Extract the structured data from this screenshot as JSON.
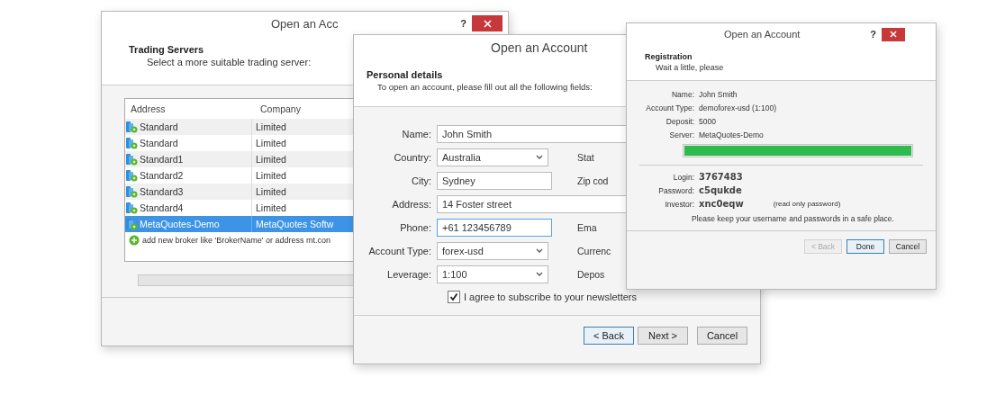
{
  "servers_dialog": {
    "title": "Open an Acc",
    "help": "?",
    "heading": "Trading Servers",
    "subheading": "Select a more suitable trading server:",
    "columns": [
      "Address",
      "Company"
    ],
    "rows": [
      {
        "address": "Standard",
        "company": "Limited",
        "selected": false
      },
      {
        "address": "Standard",
        "company": "Limited",
        "selected": false
      },
      {
        "address": "Standard1",
        "company": "Limited",
        "selected": false
      },
      {
        "address": "Standard2",
        "company": "Limited",
        "selected": false
      },
      {
        "address": "Standard3",
        "company": "Limited",
        "selected": false
      },
      {
        "address": "Standard4",
        "company": "Limited",
        "selected": false
      },
      {
        "address": "MetaQuotes-Demo",
        "company": "MetaQuotes Softw",
        "selected": true
      }
    ],
    "add_row": "add new broker like 'BrokerName' or address mt.con",
    "progress": {
      "level": 0
    }
  },
  "details_dialog": {
    "title": "Open an Account",
    "heading": "Personal details",
    "subheading": "To open an account, please fill out all the following fields:",
    "fields": [
      {
        "label": "Name:",
        "kind": "text",
        "value": "John Smith",
        "focused": false
      },
      {
        "label": "Country:",
        "kind": "select",
        "value": "Australia",
        "focused": false,
        "side_label": "Stat"
      },
      {
        "label": "City:",
        "kind": "text",
        "value": "Sydney",
        "focused": false,
        "side_label": "Zip cod"
      },
      {
        "label": "Address:",
        "kind": "text",
        "value": "14 Foster street",
        "focused": false
      },
      {
        "label": "Phone:",
        "kind": "text",
        "value": "+61 123456789",
        "focused": true,
        "side_label": "Ema"
      },
      {
        "label": "Account Type:",
        "kind": "select",
        "value": "forex-usd",
        "focused": false,
        "side_label": "Currenc"
      },
      {
        "label": "Leverage:",
        "kind": "select",
        "value": "1:100",
        "focused": false,
        "side_label": "Depos"
      }
    ],
    "newsletter": {
      "label": "I agree to subscribe to your newsletters",
      "checked": true
    },
    "buttons": [
      {
        "label": "< Back",
        "default": true
      },
      {
        "label": "Next >",
        "default": false
      },
      {
        "label": "Cancel",
        "default": false
      }
    ]
  },
  "registration_dialog": {
    "title": "Open an Account",
    "help": "?",
    "heading": "Registration",
    "subheading": "Wait a little, please",
    "summary": [
      {
        "label": "Name:",
        "value": "John Smith"
      },
      {
        "label": "Account Type:",
        "value": "demoforex-usd (1:100)"
      },
      {
        "label": "Deposit:",
        "value": "5000"
      },
      {
        "label": "Server:",
        "value": "MetaQuotes-Demo"
      }
    ],
    "progress": {
      "level": 1
    },
    "credentials": [
      {
        "label": "Login:",
        "value": "3767483"
      },
      {
        "label": "Password:",
        "value": "c5qukde"
      },
      {
        "label": "Investor:",
        "value": "xnc0eqw",
        "note": "(read only password)"
      }
    ],
    "notice": "Please keep your username and passwords in a safe place.",
    "buttons": [
      {
        "label": "< Back",
        "disabled": true,
        "default": false
      },
      {
        "label": "Done",
        "disabled": false,
        "default": true
      },
      {
        "label": "Cancel",
        "disabled": false,
        "default": false
      }
    ]
  }
}
